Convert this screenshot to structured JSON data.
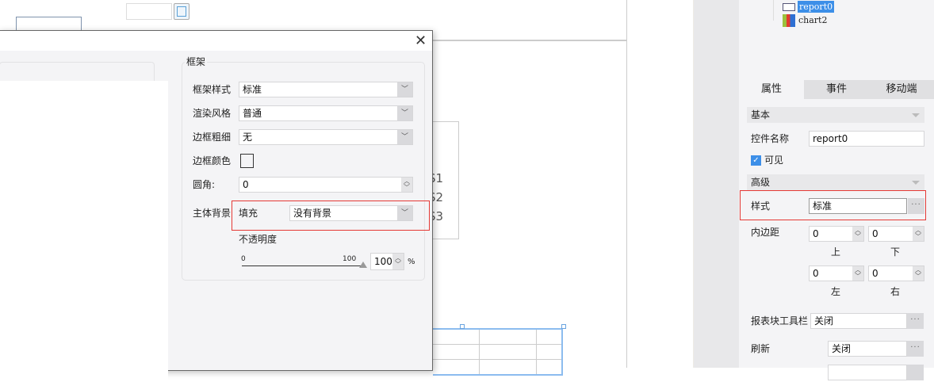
{
  "canvas": {
    "series_labels": [
      "S1",
      "S2",
      "S3"
    ]
  },
  "dialog": {
    "close_icon": "close-icon",
    "group_title": "框架",
    "rows": [
      {
        "label": "框架样式",
        "value": "标准"
      },
      {
        "label": "渲染风格",
        "value": "普通"
      },
      {
        "label": "边框粗细",
        "value": "无"
      }
    ],
    "border_color_label": "边框颜色",
    "radius_label": "圆角:",
    "radius_value": "0",
    "bg_label": "主体背景",
    "fill_label": "填充",
    "fill_value": "没有背景",
    "opacity_label": "不透明度",
    "slider_min": "0",
    "slider_max": "100",
    "opacity_value": "100",
    "opacity_percent": 100,
    "percent_sign": "%"
  },
  "tree": {
    "items": [
      {
        "label": "report0",
        "selected": true
      },
      {
        "label": "chart2"
      }
    ]
  },
  "tabs": [
    {
      "label": "属性",
      "active": true
    },
    {
      "label": "事件"
    },
    {
      "label": "移动端"
    }
  ],
  "props": {
    "basic": "基本",
    "name_label": "控件名称",
    "name_value": "report0",
    "visible_label": "可见",
    "visible_checked": true,
    "advanced": "高级",
    "style_label": "样式",
    "style_value": "标准",
    "padding_label": "内边距",
    "padding": {
      "top": "0",
      "bottom": "0",
      "left": "0",
      "right": "0"
    },
    "padding_captions": {
      "top": "上",
      "bottom": "下",
      "left": "左",
      "right": "右"
    },
    "toolbar_label": "报表块工具栏",
    "toolbar_value": "关闭",
    "refresh_label": "刷新",
    "refresh_value": "关闭",
    "more": "···"
  },
  "colors": {
    "accent": "#3d8fe8",
    "highlight": "#e53935"
  }
}
